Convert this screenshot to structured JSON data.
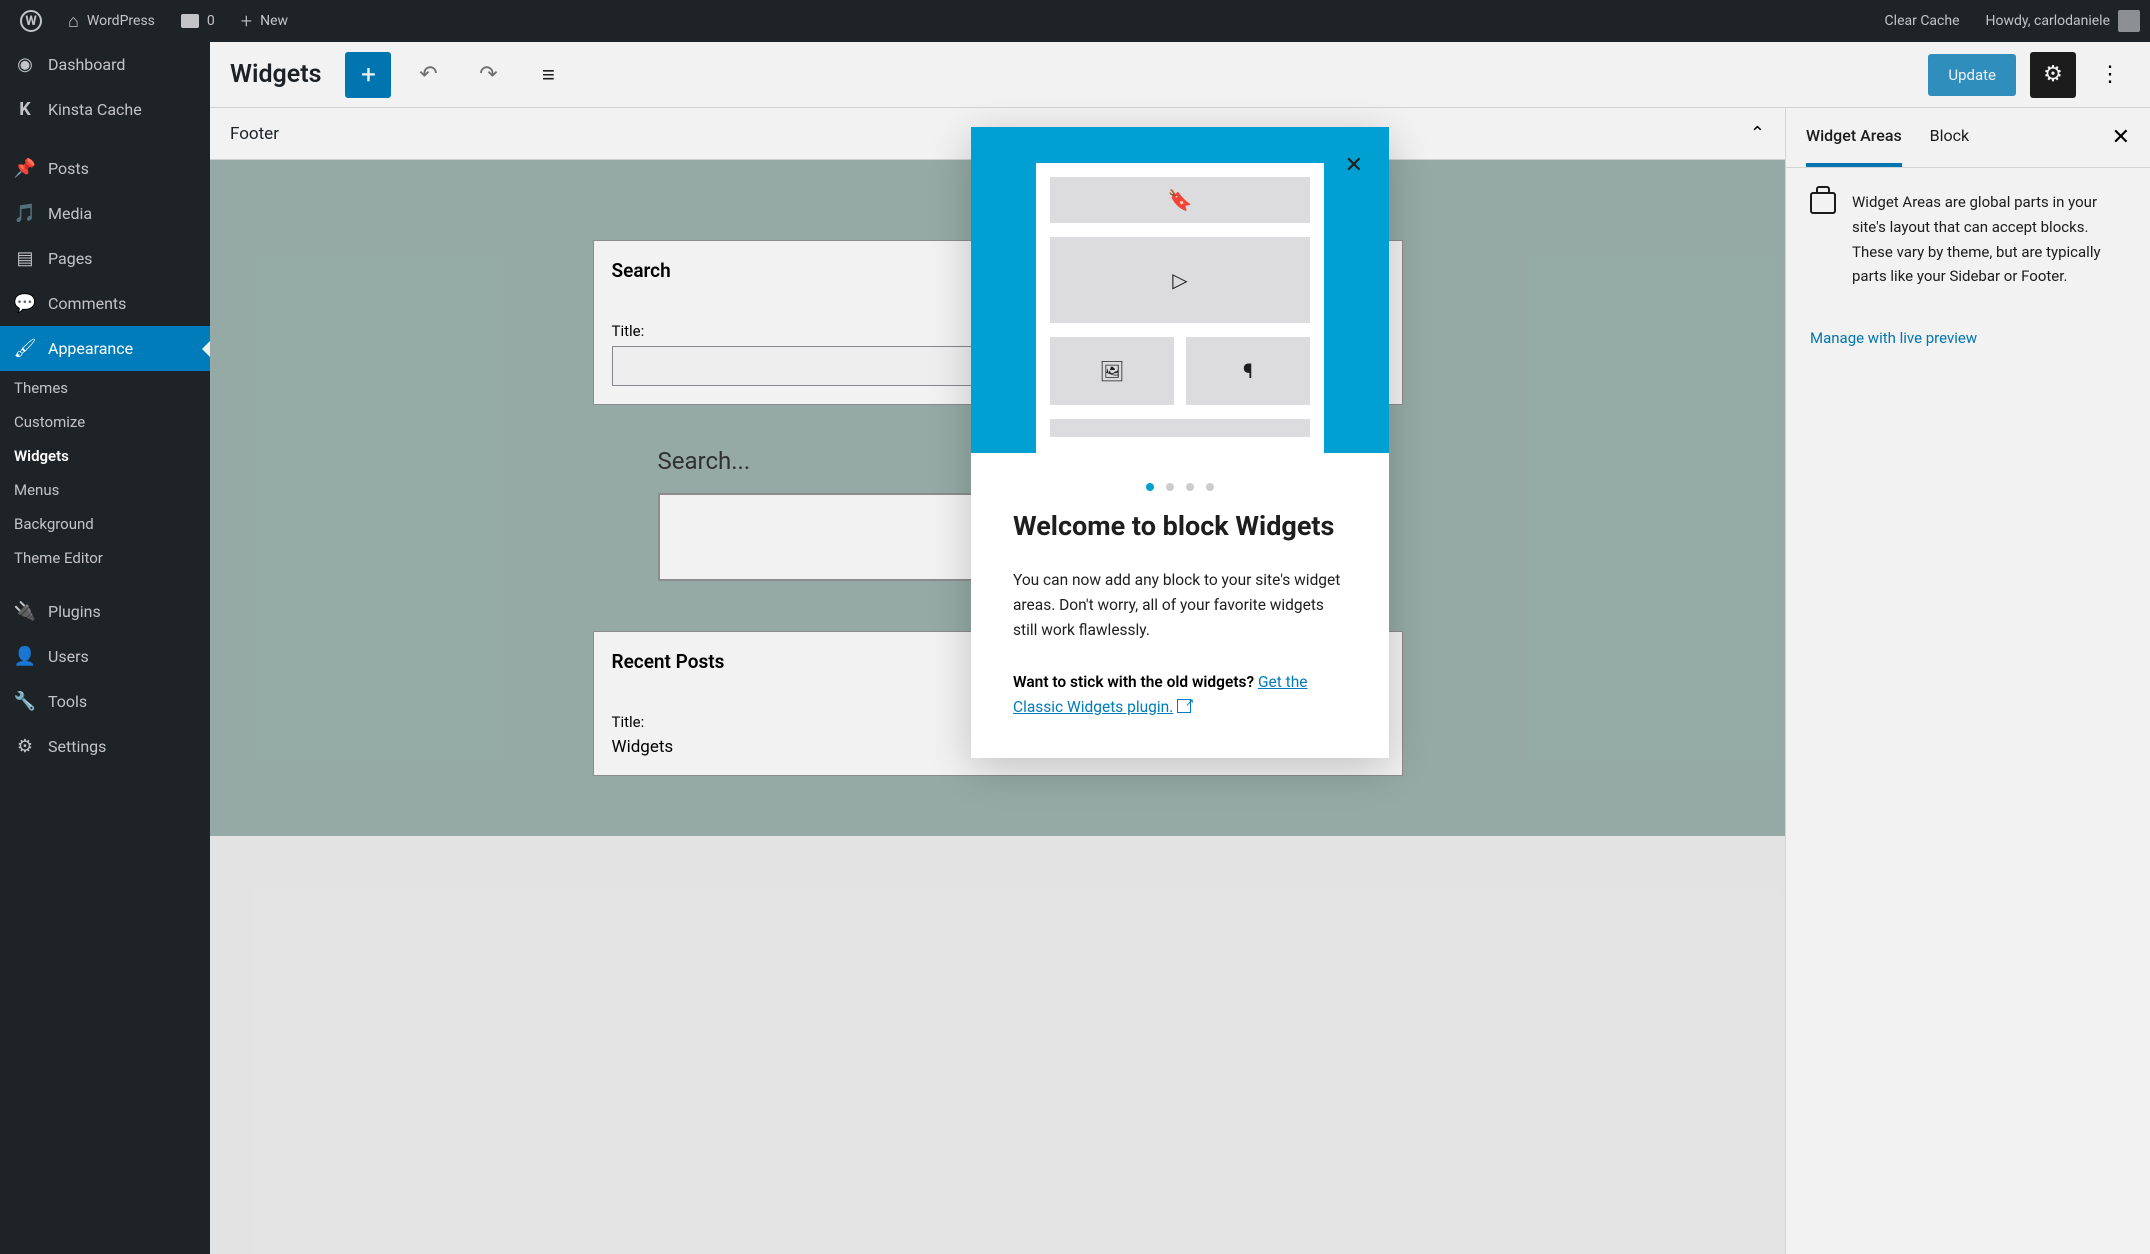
{
  "topbar": {
    "site_name": "WordPress",
    "comment_count": "0",
    "new_label": "New",
    "clear_cache": "Clear Cache",
    "howdy": "Howdy, carlodaniele"
  },
  "sidebar": {
    "items": [
      {
        "icon": "dashboard",
        "label": "Dashboard"
      },
      {
        "icon": "kinsta",
        "label": "Kinsta Cache"
      },
      {
        "icon": "pin",
        "label": "Posts"
      },
      {
        "icon": "media",
        "label": "Media"
      },
      {
        "icon": "page",
        "label": "Pages"
      },
      {
        "icon": "comment",
        "label": "Comments"
      },
      {
        "icon": "brush",
        "label": "Appearance",
        "current": true
      },
      {
        "icon": "plug",
        "label": "Plugins"
      },
      {
        "icon": "user",
        "label": "Users"
      },
      {
        "icon": "wrench",
        "label": "Tools"
      },
      {
        "icon": "sliders",
        "label": "Settings"
      }
    ],
    "sub": [
      {
        "label": "Themes"
      },
      {
        "label": "Customize"
      },
      {
        "label": "Widgets",
        "current": true
      },
      {
        "label": "Menus"
      },
      {
        "label": "Background"
      },
      {
        "label": "Theme Editor"
      }
    ]
  },
  "header": {
    "title": "Widgets",
    "update": "Update"
  },
  "section": {
    "title": "Footer"
  },
  "widgets": {
    "search": {
      "title": "Search",
      "label": "Title:"
    },
    "recent": {
      "title": "Recent Posts",
      "label": "Title:",
      "value": "Widgets"
    },
    "preview_label": "Search..."
  },
  "panel": {
    "tabs": [
      {
        "label": "Widget Areas",
        "active": true
      },
      {
        "label": "Block"
      }
    ],
    "text": "Widget Areas are global parts in your site's layout that can accept blocks. These vary by theme, but are typically parts like your Sidebar or Footer.",
    "link": "Manage with live preview"
  },
  "modal": {
    "title": "Welcome to block Widgets",
    "body": "You can now add any block to your site's widget areas. Don't worry, all of your favorite widgets still work flawlessly.",
    "cta_prefix": "Want to stick with the old widgets? ",
    "cta_link": "Get the Classic Widgets plugin."
  }
}
